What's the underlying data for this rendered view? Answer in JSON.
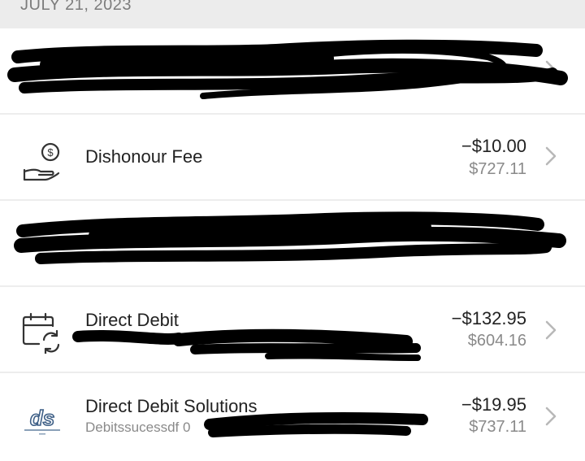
{
  "date_header": "JULY 21, 2023",
  "transactions": [
    {
      "title": "",
      "subtitle": "",
      "amount": "",
      "balance": ""
    },
    {
      "title": "Dishonour Fee",
      "subtitle": "",
      "amount": "−$10.00",
      "balance": "$727.11",
      "icon": "dollar-hand-icon"
    },
    {
      "title": "",
      "subtitle": "",
      "amount": "",
      "balance": ""
    },
    {
      "title": "Direct Debit",
      "subtitle": "",
      "amount": "−$132.95",
      "balance": "$604.16",
      "icon": "calendar-refresh-icon"
    },
    {
      "title": "Direct Debit Solutions",
      "subtitle": "Debitssucessdf 0",
      "amount": "−$19.95",
      "balance": "$737.11",
      "icon": "ds-logo-icon"
    }
  ],
  "colors": {
    "background": "#ededed",
    "row": "#ffffff",
    "text": "#222222",
    "muted": "#8a8a8a",
    "redaction": "#000000"
  }
}
